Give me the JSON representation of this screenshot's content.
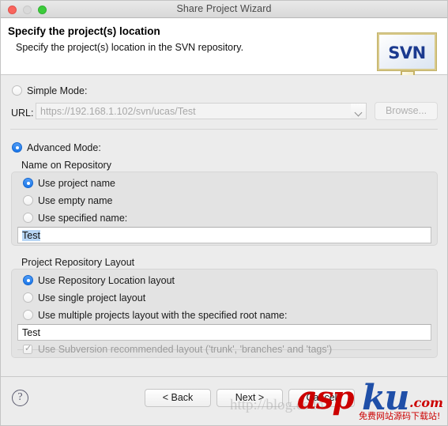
{
  "window": {
    "title": "Share Project Wizard",
    "traffic_lights": [
      "close",
      "minimize",
      "zoom"
    ]
  },
  "header": {
    "title": "Specify the project(s) location",
    "subtitle": "Specify the project(s) location in the SVN repository.",
    "logo_text": "SVN"
  },
  "form": {
    "simple_mode": {
      "label": "Simple Mode:",
      "selected": false
    },
    "url": {
      "label": "URL:",
      "value": "https://192.168.1.102/svn/ucas/Test",
      "disabled": true,
      "browse_label": "Browse...",
      "dropdown_icon": "chevron-down-icon"
    },
    "advanced_mode": {
      "label": "Advanced Mode:",
      "selected": true
    },
    "name_on_repository": {
      "group_label": "Name on Repository",
      "options": [
        {
          "label": "Use project name",
          "selected": true
        },
        {
          "label": "Use empty name",
          "selected": false
        },
        {
          "label": "Use specified name:",
          "selected": false
        }
      ],
      "name_field_value": "Test",
      "name_field_selected": true
    },
    "project_repository_layout": {
      "group_label": "Project Repository Layout",
      "options": [
        {
          "label": "Use Repository Location layout",
          "selected": true
        },
        {
          "label": "Use single project layout",
          "selected": false
        },
        {
          "label": "Use multiple projects layout with the specified root name:",
          "selected": false
        }
      ],
      "root_name_field_value": "Test",
      "checkbox": {
        "label": "Use Subversion recommended layout ('trunk', 'branches' and 'tags')",
        "checked": true,
        "disabled": true
      }
    }
  },
  "footer": {
    "help_icon": "?",
    "back_label": "< Back",
    "next_label": "Next >",
    "cancel_label": "Cancel"
  },
  "watermark": {
    "asp": "asp",
    "ku": "ku",
    "com": ".com",
    "tagline": "免费网站源码下载站!",
    "url": "http://blog.csdn"
  },
  "colors": {
    "accent": "#1a76e8",
    "selection": "#b8d6f5",
    "panel": "#ececec",
    "group": "#e3e3e3",
    "watermark_red": "#cc0000",
    "watermark_blue": "#1f4fa8",
    "svn_blue": "#1b3a8f"
  }
}
